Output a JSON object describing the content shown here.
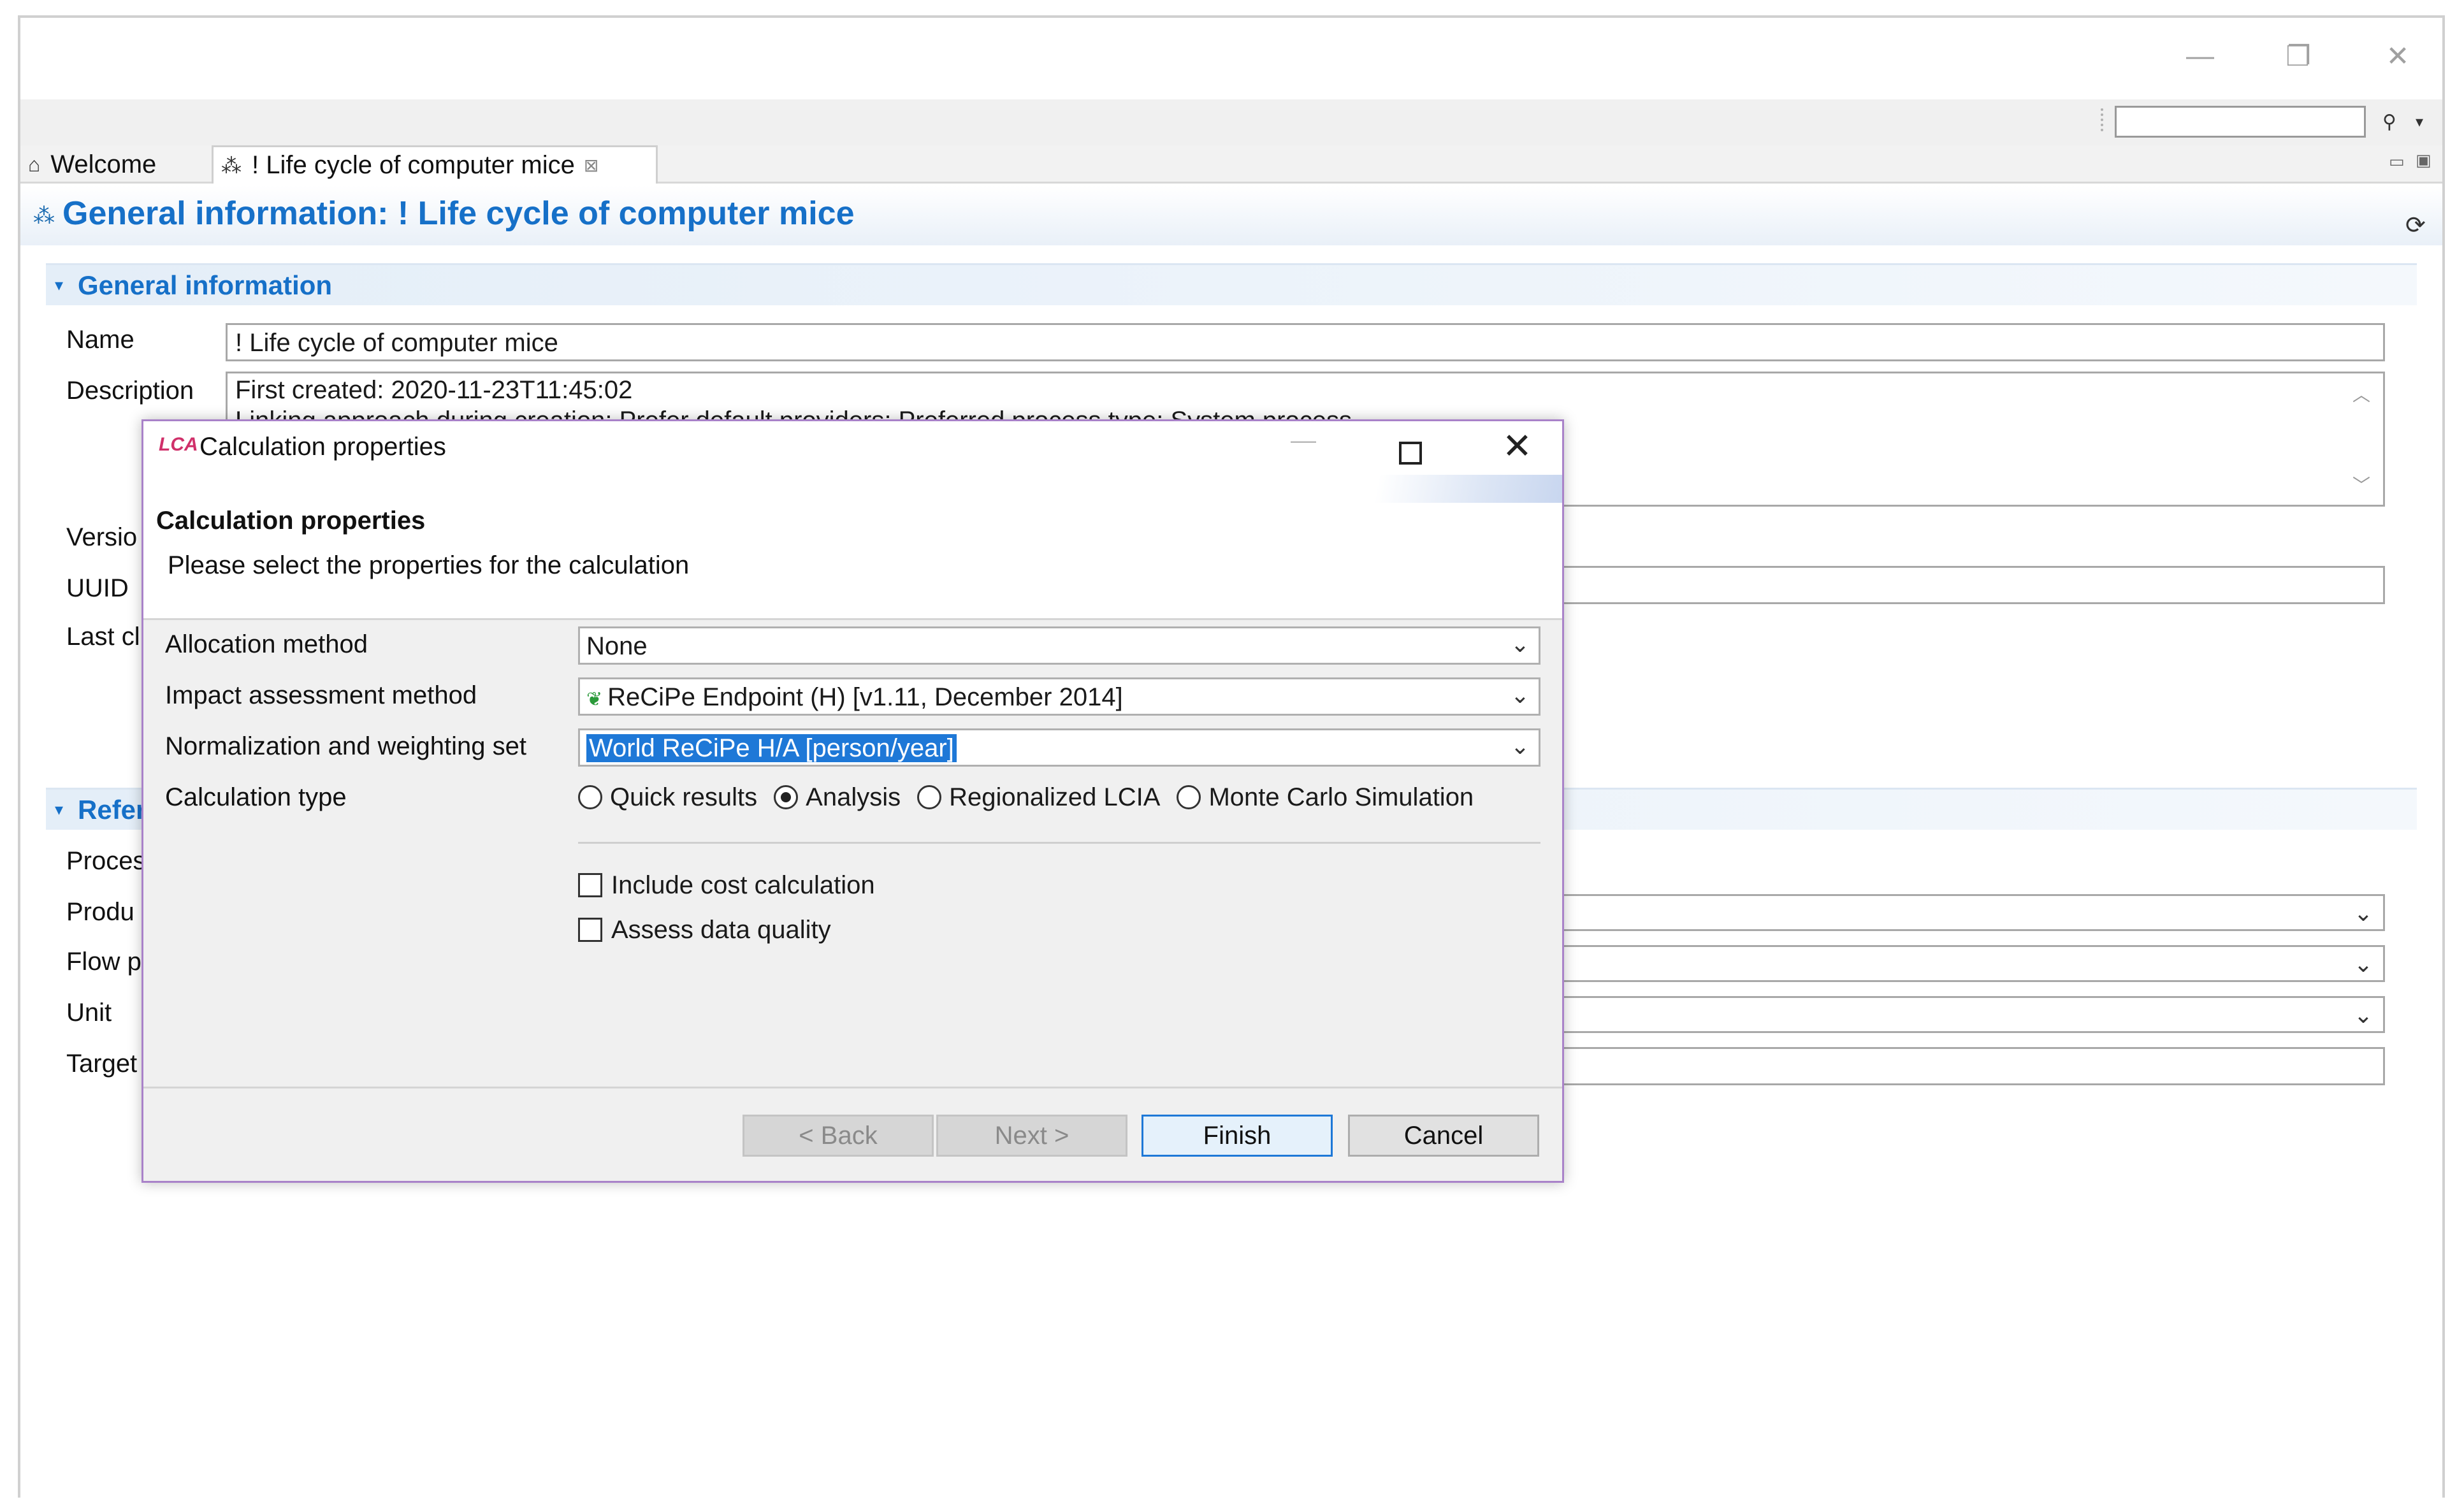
{
  "window": {
    "controls": {
      "minimize": "—",
      "restore": "❐",
      "close": "✕"
    }
  },
  "toolbar": {
    "search_icon": "search-icon",
    "search_glyph": "⚲",
    "dropdown_glyph": "▾"
  },
  "tabs": [
    {
      "label": "Welcome",
      "icon": "⌂"
    },
    {
      "label": "!  Life cycle of computer mice",
      "icon": "⁂",
      "close": "⊠"
    }
  ],
  "view_controls": {
    "minimize": "▭",
    "maximize": "▣"
  },
  "editor": {
    "title": "General information: !  Life cycle of computer mice",
    "title_icon": "⁂",
    "refresh_glyph": "⟳",
    "general_section": {
      "twisty": "▾",
      "title": "General information",
      "labels": {
        "name": "Name",
        "description": "Description",
        "version": "Versio",
        "uuid": "UUID",
        "last_change": "Last cl"
      },
      "name_value": "!  Life cycle of computer mice",
      "description_lines": [
        "First created: 2020-11-23T11:45:02",
        "Linking approach during creation: Prefer default providers; Preferred process type: System process"
      ],
      "scroll_up": "︿",
      "scroll_down": "﹀"
    },
    "reference_section": {
      "twisty": "▾",
      "title": "Refer",
      "labels": {
        "process": "Proces",
        "product": "Produ",
        "flow_property": "Flow p",
        "unit": "Unit",
        "target": "Target"
      },
      "combo_arrow": "⌄"
    }
  },
  "dialog": {
    "icon_text": "LCA",
    "title": "Calculation properties",
    "controls": {
      "minimize": "—",
      "close": "✕"
    },
    "banner_title": "Calculation properties",
    "banner_message": "Please select the properties for the calculation",
    "fields": {
      "allocation_label": "Allocation method",
      "allocation_value": "None",
      "impact_label": "Impact assessment method",
      "impact_value": "ReCiPe Endpoint (H) [v1.11,  December 2014]",
      "normalization_label": "Normalization and weighting set",
      "normalization_value": "World ReCiPe H/A [person/year]",
      "calc_type_label": "Calculation type"
    },
    "calculation_types": [
      {
        "label": "Quick results",
        "selected": false
      },
      {
        "label": "Analysis",
        "selected": true
      },
      {
        "label": "Regionalized LCIA",
        "selected": false
      },
      {
        "label": "Monte Carlo Simulation",
        "selected": false
      }
    ],
    "checkboxes": {
      "cost_label": "Include cost calculation",
      "cost_checked": false,
      "quality_label": "Assess data quality",
      "quality_checked": false
    },
    "buttons": {
      "back": "< Back",
      "next": "Next >",
      "finish": "Finish",
      "cancel": "Cancel"
    },
    "combo_arrow": "⌄",
    "leaf_glyph": "❦"
  },
  "colors": {
    "accent_blue": "#1670c8",
    "selection_blue": "#1e78d7",
    "dialog_border": "#a982c9"
  }
}
